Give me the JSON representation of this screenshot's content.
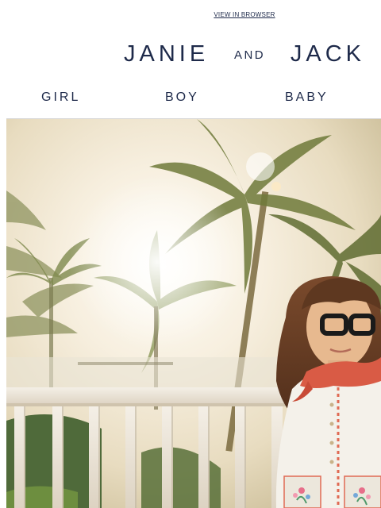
{
  "preheader": {
    "view_in_browser": "VIEW IN BROWSER"
  },
  "brand": {
    "word1": "JANIE",
    "connector": "AND",
    "word2": "JACK",
    "color": "#1e2a4a"
  },
  "nav": {
    "items": [
      {
        "label": "GIRL"
      },
      {
        "label": "BOY"
      },
      {
        "label": "BABY"
      }
    ]
  },
  "hero": {
    "subject": "girl in white dress with red scarf and black glasses on a balcony with palm trees"
  }
}
